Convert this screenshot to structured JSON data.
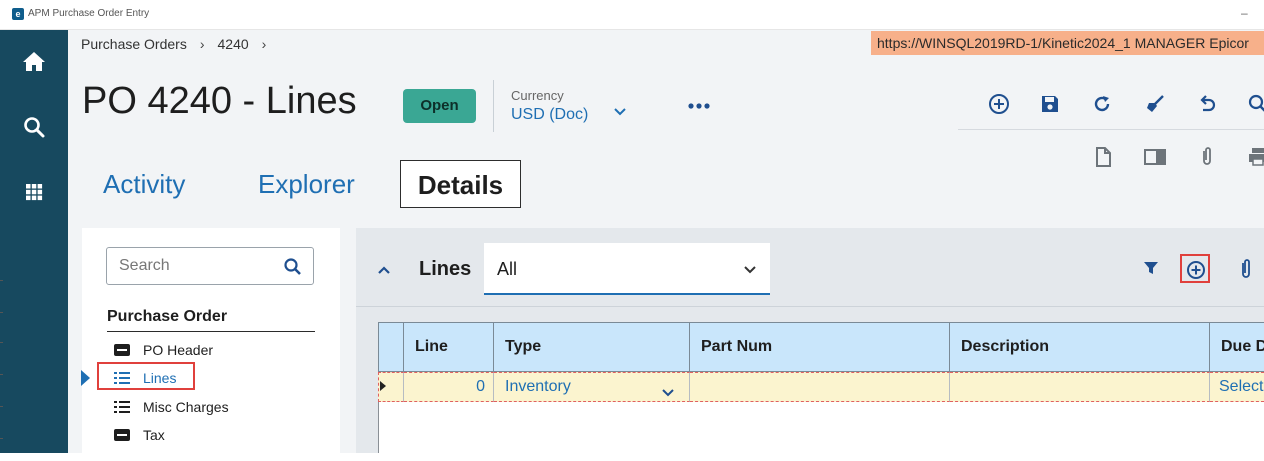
{
  "window": {
    "title": "APM Purchase Order Entry",
    "minimize_glyph": "–"
  },
  "nav": {
    "items": [
      {
        "icon": "home-icon"
      },
      {
        "icon": "search-icon"
      },
      {
        "icon": "apps-grid-icon"
      }
    ]
  },
  "breadcrumb": {
    "root": "Purchase Orders",
    "current": "4240",
    "separator": "›"
  },
  "server_banner": "https://WINSQL2019RD-1/Kinetic2024_1   MANAGER   Epicor",
  "page": {
    "title": "PO 4240 - Lines",
    "status": "Open",
    "currency_label": "Currency",
    "currency_value": "USD (Doc)",
    "more_glyph": "•••"
  },
  "toolbar": {
    "row1": [
      "add-icon",
      "save-icon",
      "refresh-icon",
      "clear-icon",
      "undo-icon",
      "search-icon"
    ],
    "row2": [
      "new-document-icon",
      "panel-icon",
      "attachment-icon",
      "print-icon"
    ]
  },
  "tabs": [
    {
      "label": "Activity",
      "active": false
    },
    {
      "label": "Explorer",
      "active": false
    },
    {
      "label": "Details",
      "active": true
    }
  ],
  "sidebar": {
    "search_placeholder": "Search",
    "section_title": "Purchase Order",
    "items": [
      {
        "label": "PO Header",
        "icon": "card-icon"
      },
      {
        "label": "Lines",
        "icon": "list-icon",
        "selected": true
      },
      {
        "label": "Misc Charges",
        "icon": "list-icon"
      },
      {
        "label": "Tax",
        "icon": "card-icon"
      }
    ]
  },
  "lines_panel": {
    "title": "Lines",
    "filter_value": "All",
    "columns": [
      "Line",
      "Type",
      "Part Num",
      "Description",
      "Due Date"
    ],
    "rows": [
      {
        "line": "0",
        "type": "Inventory",
        "part_num": "",
        "description": "",
        "due_date": "Select"
      }
    ]
  },
  "colors": {
    "nav_bg": "#17495f",
    "accent": "#1f6fb3",
    "status_open": "#3aa794",
    "banner": "#f7b08a",
    "highlight_red": "#e0403c",
    "grid_header": "#c9e6fb",
    "row_new": "#fbf4cf"
  }
}
